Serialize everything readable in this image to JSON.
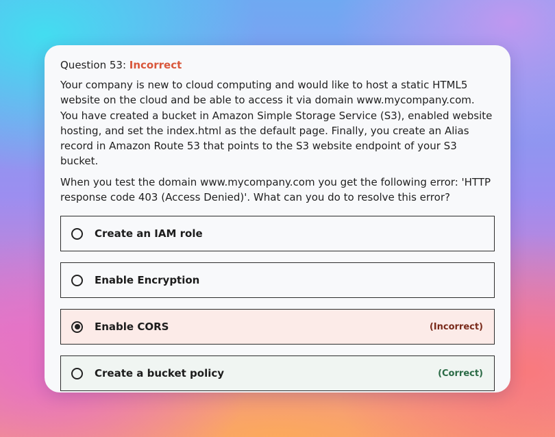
{
  "question": {
    "label": "Question 53:",
    "status": "Incorrect",
    "paragraphs": [
      "Your company is new to cloud computing and would like to host a static HTML5 website on the cloud and be able to access it via domain www.mycompany.com. You have created a bucket in Amazon Simple Storage Service (S3), enabled website hosting, and set the index.html as the default page. Finally, you create an Alias record in Amazon Route 53 that points to the S3 website endpoint of your S3 bucket.",
      "When you test the domain www.mycompany.com you get the following error: 'HTTP response code 403 (Access Denied)'. What can you do to resolve this error?"
    ]
  },
  "options": [
    {
      "label": "Create an IAM role",
      "selected": false,
      "tag": ""
    },
    {
      "label": "Enable Encryption",
      "selected": false,
      "tag": ""
    },
    {
      "label": "Enable CORS",
      "selected": true,
      "tag": "(Incorrect)"
    },
    {
      "label": "Create a bucket policy",
      "selected": false,
      "tag": "(Correct)"
    }
  ],
  "colors": {
    "status_incorrect": "#d9573b",
    "incorrect_bg": "#fcebe8",
    "correct_bg": "#f0f5f2",
    "incorrect_tag": "#7a2a1a",
    "correct_tag": "#2a6a45"
  },
  "icons": {
    "radio_unselected": "radio-unselected-icon",
    "radio_selected": "radio-selected-icon"
  }
}
